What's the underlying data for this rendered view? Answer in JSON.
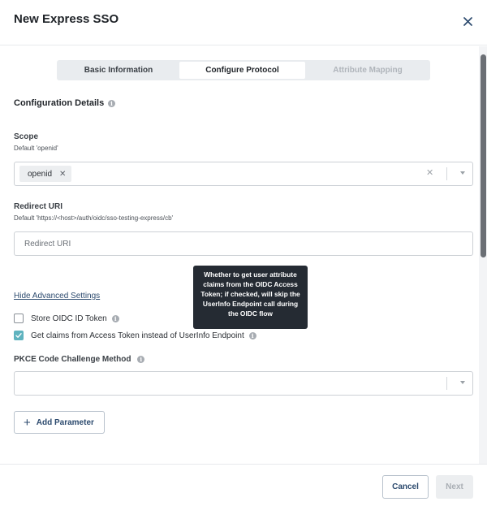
{
  "dialog": {
    "title": "New Express SSO"
  },
  "tabs": [
    {
      "label": "Basic Information",
      "state": "inactive"
    },
    {
      "label": "Configure Protocol",
      "state": "active"
    },
    {
      "label": "Attribute Mapping",
      "state": "disabled"
    }
  ],
  "configuration": {
    "section_title": "Configuration Details",
    "scope": {
      "label": "Scope",
      "help": "Default 'openid'",
      "selected_chip": "openid"
    },
    "redirect_uri": {
      "label": "Redirect URI",
      "help": "Default 'https://<host>/auth/oidc/sso-testing-express/cb'",
      "placeholder": "Redirect URI",
      "value": ""
    },
    "advanced_link": "Hide Advanced Settings",
    "store_token": {
      "label": "Store OIDC ID Token",
      "checked": false
    },
    "claims_from_token": {
      "label": "Get claims from Access Token instead of UserInfo Endpoint",
      "checked": true
    },
    "tooltip": "Whether to get user attribute claims from the OIDC Access Token; if checked, will skip the UserInfo Endpoint call during the OIDC flow",
    "pkce": {
      "label": "PKCE Code Challenge Method",
      "value": ""
    },
    "add_parameter": "Add Parameter"
  },
  "footer": {
    "cancel_label": "Cancel",
    "next_label": "Next"
  },
  "colors": {
    "accent_teal": "#5fb3bf",
    "link_blue": "#2c4a6e",
    "tooltip_bg": "#252b33"
  }
}
